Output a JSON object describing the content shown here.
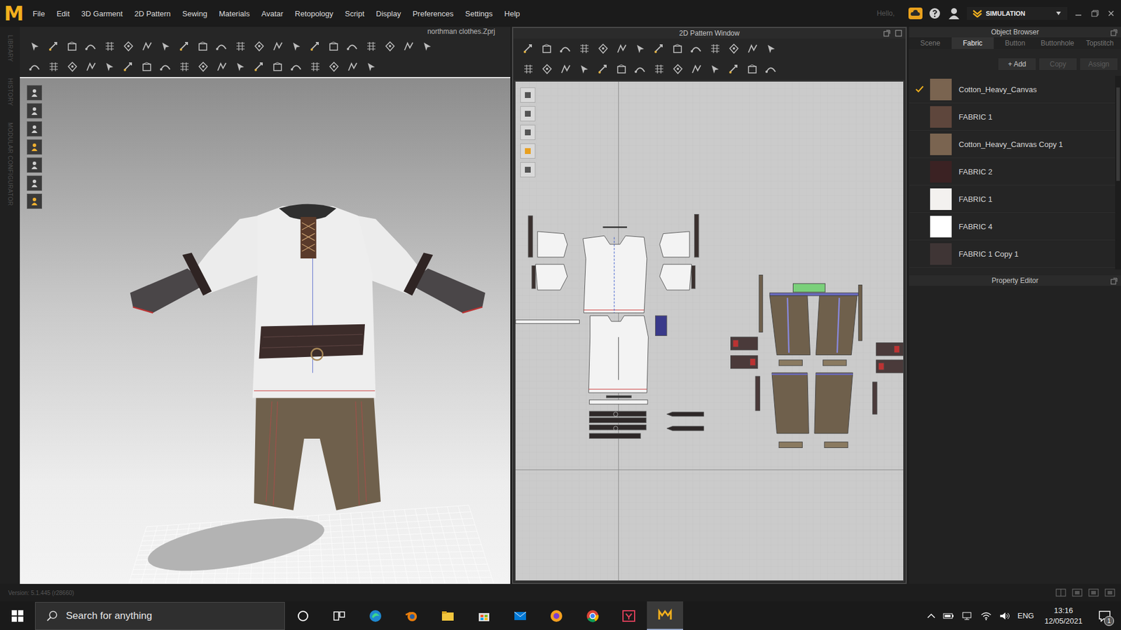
{
  "app": {
    "logo": "M",
    "greeting": "Hello,",
    "mode": "SIMULATION"
  },
  "menu": [
    "File",
    "Edit",
    "3D Garment",
    "2D Pattern",
    "Sewing",
    "Materials",
    "Avatar",
    "Retopology",
    "Script",
    "Display",
    "Preferences",
    "Settings",
    "Help"
  ],
  "side_tabs": [
    "LIBRARY",
    "HISTORY",
    "MODULAR CONFIGURATOR"
  ],
  "viewport": {
    "file_title": "northman clothes.Zprj"
  },
  "pattern_window": {
    "title": "2D Pattern Window"
  },
  "object_browser": {
    "title": "Object Browser",
    "tabs": [
      {
        "label": "Scene",
        "selected": false
      },
      {
        "label": "Fabric",
        "selected": true
      },
      {
        "label": "Button",
        "selected": false
      },
      {
        "label": "Buttonhole",
        "selected": false
      },
      {
        "label": "Topstitch",
        "selected": false
      }
    ],
    "actions": [
      {
        "label": "+ Add",
        "disabled": false
      },
      {
        "label": "Copy",
        "disabled": true
      },
      {
        "label": "Assign",
        "disabled": true
      }
    ],
    "fabrics": [
      {
        "name": "Cotton_Heavy_Canvas",
        "checked": true,
        "color": "#7a6450"
      },
      {
        "name": "FABRIC 1",
        "checked": false,
        "color": "#5e463c"
      },
      {
        "name": "Cotton_Heavy_Canvas Copy 1",
        "checked": false,
        "color": "#7a6450"
      },
      {
        "name": "FABRIC 2",
        "checked": false,
        "color": "#3b2223"
      },
      {
        "name": "FABRIC 1",
        "checked": false,
        "color": "#f3f1ef"
      },
      {
        "name": "FABRIC 4",
        "checked": false,
        "color": "#ffffff"
      },
      {
        "name": "FABRIC 1 Copy 1",
        "checked": false,
        "color": "#3f3535"
      }
    ]
  },
  "property_editor": {
    "title": "Property Editor"
  },
  "status": {
    "version": "Version: 5.1.445 (r28660)"
  },
  "taskbar": {
    "search_placeholder": "Search for anything",
    "language": "ENG",
    "time": "13:16",
    "date": "12/05/2021",
    "notifications": "1"
  }
}
